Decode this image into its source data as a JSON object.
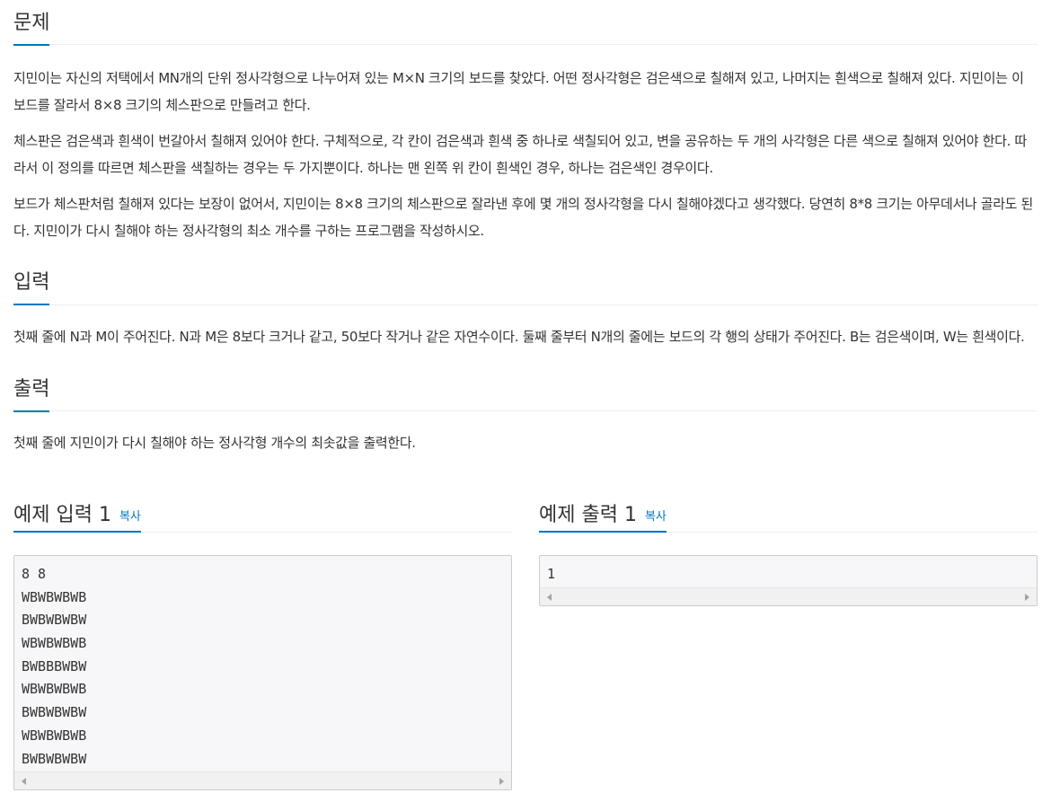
{
  "problem": {
    "title": "문제",
    "paragraphs": [
      "지민이는 자신의 저택에서 MN개의 단위 정사각형으로 나누어져 있는 M×N 크기의 보드를 찾았다. 어떤 정사각형은 검은색으로 칠해져 있고, 나머지는 흰색으로 칠해져 있다. 지민이는 이 보드를 잘라서 8×8 크기의 체스판으로 만들려고 한다.",
      "체스판은 검은색과 흰색이 번갈아서 칠해져 있어야 한다. 구체적으로, 각 칸이 검은색과 흰색 중 하나로 색칠되어 있고, 변을 공유하는 두 개의 사각형은 다른 색으로 칠해져 있어야 한다. 따라서 이 정의를 따르면 체스판을 색칠하는 경우는 두 가지뿐이다. 하나는 맨 왼쪽 위 칸이 흰색인 경우, 하나는 검은색인 경우이다.",
      "보드가 체스판처럼 칠해져 있다는 보장이 없어서, 지민이는 8×8 크기의 체스판으로 잘라낸 후에 몇 개의 정사각형을 다시 칠해야겠다고 생각했다. 당연히 8*8 크기는 아무데서나 골라도 된다. 지민이가 다시 칠해야 하는 정사각형의 최소 개수를 구하는 프로그램을 작성하시오."
    ]
  },
  "input": {
    "title": "입력",
    "text": "첫째 줄에 N과 M이 주어진다. N과 M은 8보다 크거나 같고, 50보다 작거나 같은 자연수이다. 둘째 줄부터 N개의 줄에는 보드의 각 행의 상태가 주어진다. B는 검은색이며, W는 흰색이다."
  },
  "output": {
    "title": "출력",
    "text": "첫째 줄에 지민이가 다시 칠해야 하는 정사각형 개수의 최솟값을 출력한다."
  },
  "sample_input": {
    "title": "예제 입력 1",
    "copy_label": "복사",
    "lines": [
      "8 8",
      "WBWBWBWB",
      "BWBWBWBW",
      "WBWBWBWB",
      "BWBBBWBW",
      "WBWBWBWB",
      "BWBWBWBW",
      "WBWBWBWB",
      "BWBWBWBW"
    ]
  },
  "sample_output": {
    "title": "예제 출력 1",
    "copy_label": "복사",
    "lines": [
      "1"
    ]
  }
}
